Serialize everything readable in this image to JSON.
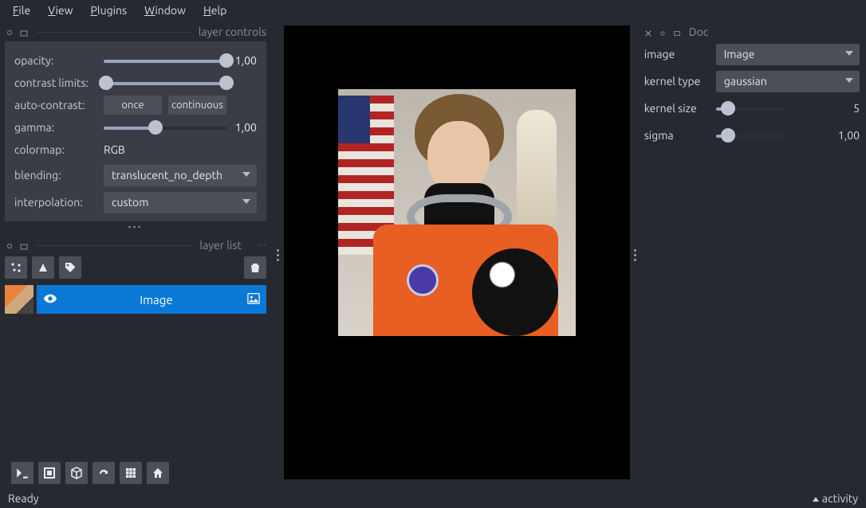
{
  "menubar": {
    "file": "File",
    "view": "View",
    "plugins": "Plugins",
    "window": "Window",
    "help": "Help"
  },
  "dock_left_title": "layer controls",
  "dock_layerlist_title": "layer list",
  "dock_right_title": "Doc",
  "layer_controls": {
    "opacity_label": "opacity:",
    "opacity_value": "1,00",
    "contrast_label": "contrast limits:",
    "autocontrast_label": "auto-contrast:",
    "once": "once",
    "continuous": "continuous",
    "gamma_label": "gamma:",
    "gamma_value": "1,00",
    "colormap_label": "colormap:",
    "colormap_value": "RGB",
    "blending_label": "blending:",
    "blending_value": "translucent_no_depth",
    "interp_label": "interpolation:",
    "interp_value": "custom"
  },
  "layer_list": {
    "layer_name": "Image"
  },
  "right_panel": {
    "image_label": "image",
    "image_value": "Image",
    "kernel_type_label": "kernel type",
    "kernel_type_value": "gaussian",
    "kernel_size_label": "kernel size",
    "kernel_size_value": "5",
    "sigma_label": "sigma",
    "sigma_value": "1,00"
  },
  "status": {
    "ready": "Ready",
    "activity": "activity"
  }
}
